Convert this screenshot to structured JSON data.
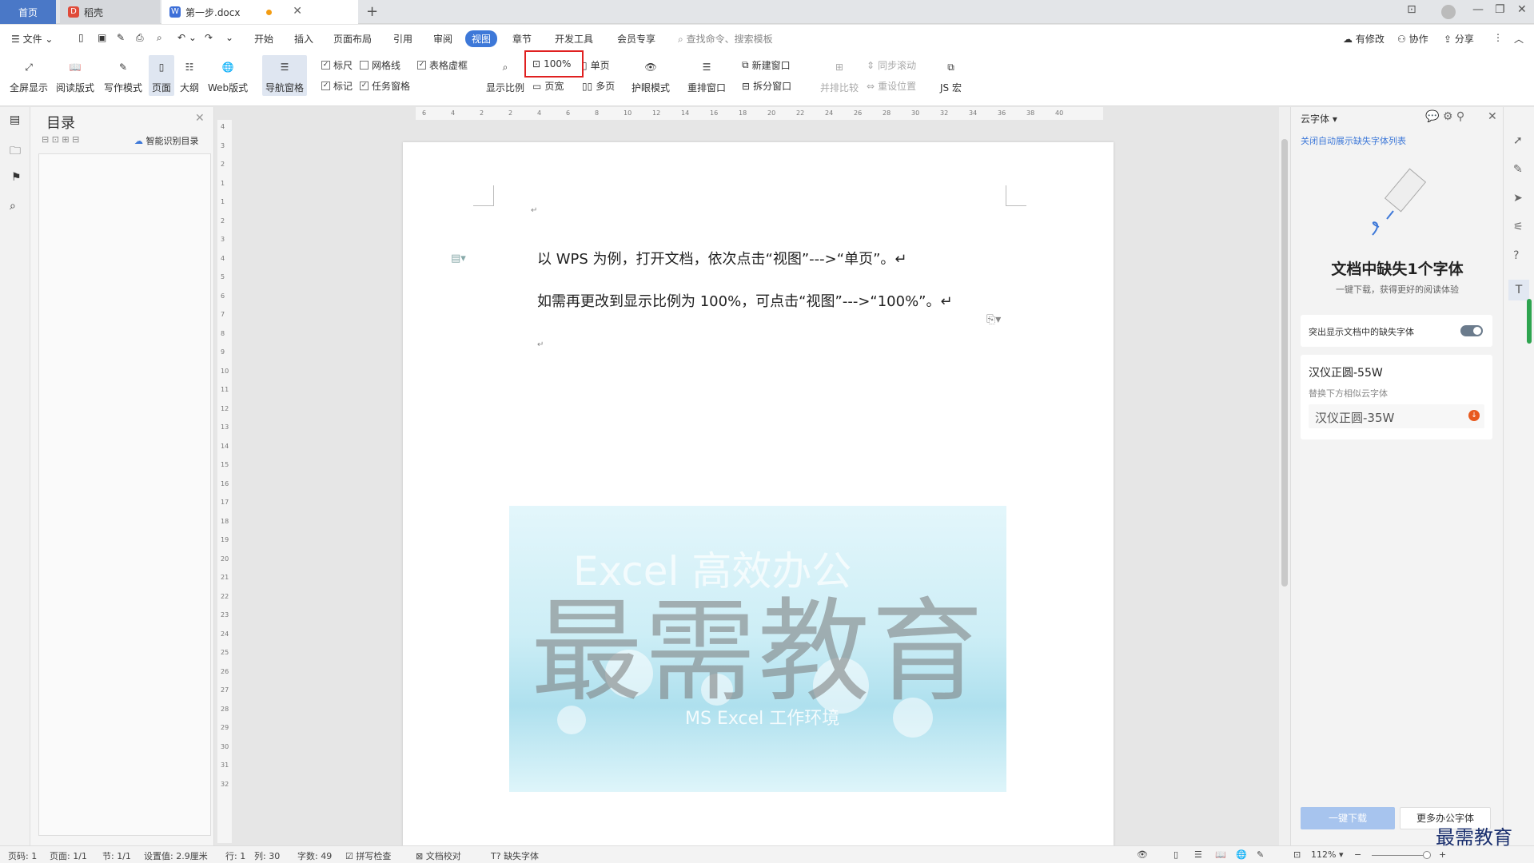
{
  "titlebar": {
    "tabs": [
      {
        "label": "首页"
      },
      {
        "label": "稻壳"
      },
      {
        "label": "第一步.docx"
      }
    ]
  },
  "menubar": {
    "file": "文件",
    "items": [
      "开始",
      "插入",
      "页面布局",
      "引用",
      "审阅",
      "视图",
      "章节",
      "开发工具",
      "会员专享"
    ],
    "search_placeholder": "查找命令、搜索模板",
    "right": {
      "modify": "有修改",
      "collab": "协作",
      "share": "分享"
    }
  },
  "ribbon": {
    "fullscreen": "全屏显示",
    "reading": "阅读版式",
    "writing": "写作模式",
    "page": "页面",
    "outline": "大纲",
    "web": "Web版式",
    "navpane": "导航窗格",
    "ruler": "标尺",
    "gridlines": "网格线",
    "table_frame": "表格虚框",
    "markup": "标记",
    "task_pane": "任务窗格",
    "zoom": "显示比例",
    "zoom100": "100%",
    "single_page": "单页",
    "page_width": "页宽",
    "multi_page": "多页",
    "eye_mode": "护眼模式",
    "rearrange": "重排窗口",
    "new_window": "新建窗口",
    "split_window": "拆分窗口",
    "side_by_side": "并排比较",
    "sync_scroll": "同步滚动",
    "reset_pos": "重设位置",
    "macro": "JS 宏"
  },
  "nav": {
    "title": "目录",
    "smart": "智能识别目录"
  },
  "ruler_marks": [
    "6",
    "4",
    "2",
    "2",
    "4",
    "6",
    "8",
    "10",
    "12",
    "14",
    "16",
    "18",
    "20",
    "22",
    "24",
    "26",
    "28",
    "30",
    "32",
    "34",
    "36",
    "38",
    "40"
  ],
  "vruler_marks": [
    "4",
    "3",
    "2",
    "1",
    "1",
    "2",
    "3",
    "4",
    "5",
    "6",
    "7",
    "8",
    "9",
    "10",
    "11",
    "12",
    "13",
    "14",
    "15",
    "16",
    "17",
    "18",
    "19",
    "20",
    "21",
    "22",
    "23",
    "24",
    "25",
    "26",
    "27",
    "28",
    "29",
    "30",
    "31",
    "32"
  ],
  "document": {
    "line1": "以 WPS 为例，打开文档，依次点击“视图”--->“单页”。↵",
    "line2": "如需再更改到显示比例为 100%，可点击“视图”--->“100%”。↵",
    "para_mark": "↵",
    "banner_text1": "Excel 高效办公",
    "banner_text2": "MS Excel 工作环境",
    "watermark": "最需教育"
  },
  "rpanel": {
    "title": "云字体",
    "close_list": "关闭自动展示缺失字体列表",
    "headline": "文档中缺失1个字体",
    "subtitle": "一键下载，获得更好的阅读体验",
    "highlight_label": "突出显示文档中的缺失字体",
    "font_name": "汉仪正圆-55W",
    "replace_hint": "替换下方相似云字体",
    "alt_font": "汉仪正圆-35W",
    "download_btn": "一键下载",
    "more_btn": "更多办公字体"
  },
  "status": {
    "page": "页码: 1",
    "pages": "页面: 1/1",
    "section": "节: 1/1",
    "setting": "设置值: 2.9厘米",
    "row": "行: 1",
    "col": "列: 30",
    "words": "字数: 49",
    "spell": "拼写检查",
    "proof": "文档校对",
    "missing_font": "缺失字体",
    "zoom": "112%"
  },
  "corner_watermark": "最需教育"
}
